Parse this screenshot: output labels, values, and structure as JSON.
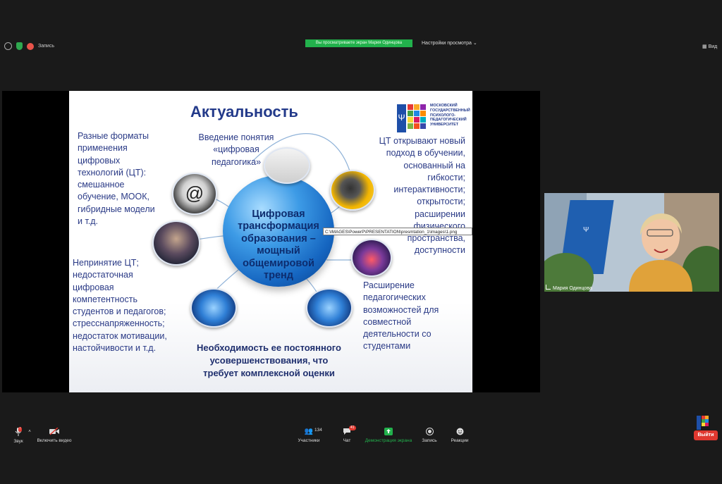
{
  "topbar": {
    "record_label": "Запись",
    "banner": "Вы просматриваете экран Мария Одинцова",
    "view_options": "Настройки просмотра",
    "view_label": "Вид"
  },
  "slide": {
    "title": "Актуальность",
    "logo_text": "МОСКОВСКИЙ ГОСУДАРСТВЕННЫЙ ПСИХОЛОГО-ПЕДАГОГИЧЕСКИЙ УНИВЕРСИТЕТ",
    "globe_lines": [
      "Цифровая",
      "трансформация",
      "образования –",
      "мощный",
      "общемировой",
      "тренд"
    ],
    "left_top": [
      "Разные форматы",
      "применения",
      "цифровых",
      "технологий (ЦТ):",
      "смешанное",
      "обучение, МООК,",
      "гибридные модели",
      "и т.д."
    ],
    "top_center": [
      "Введение понятия",
      "«цифровая",
      "педагогика»"
    ],
    "right_top": [
      "ЦТ открывают новый",
      "подход в обучении,",
      "основанный на",
      "гибкости;",
      "интерактивности;",
      "открытости;",
      "расширении",
      "физического",
      "пространства,",
      "доступности"
    ],
    "left_bottom": [
      "Непринятие ЦТ;",
      "недостаточная",
      "цифровая",
      "компетентность",
      "студентов и педагогов;",
      "стресснапряженность;",
      "недостаток мотивации,",
      "настойчивости и т.д."
    ],
    "right_bottom": [
      "Расширение",
      "педагогических",
      "возможностей для",
      "совместной",
      "деятельности со",
      "студентами"
    ],
    "bottom": [
      "Необходимость ее постоянного",
      "усовершенствования, что",
      "требует комплексной оценки"
    ],
    "tooltip": "C:\\IMAGES\\PowerP\\PRESENTATION\\presmtation_1\\images\\1.png"
  },
  "video": {
    "participant_name": "Мария Одинцова"
  },
  "toolbar": {
    "audio": "Звук",
    "audio_badge": "!",
    "video": "Включить видео",
    "participants": "Участники",
    "participants_count": "134",
    "chat": "Чат",
    "chat_badge": "41",
    "share": "Демонстрация экрана",
    "record": "Запись",
    "reactions": "Реакции",
    "exit": "Выйти"
  },
  "colors": {
    "accent_green": "#22b14c",
    "exit_red": "#e0382f",
    "slide_blue": "#233a8a"
  }
}
